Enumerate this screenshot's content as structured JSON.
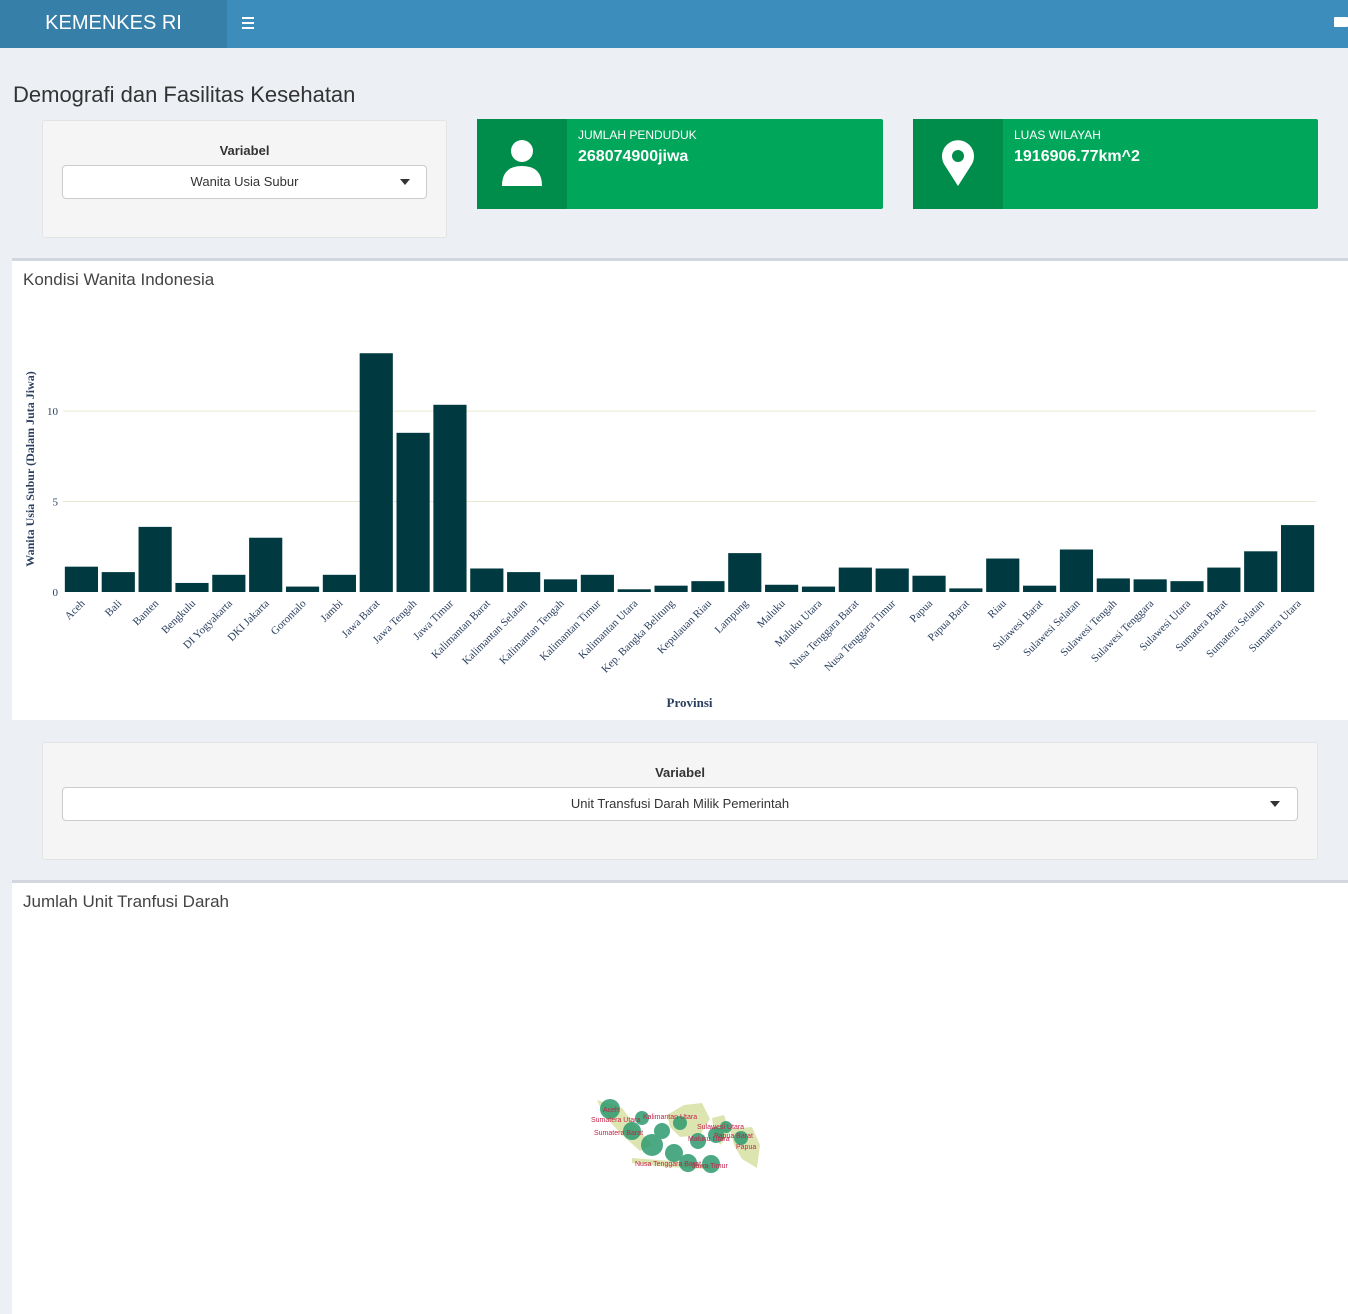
{
  "header": {
    "brand": "KEMENKES RI"
  },
  "page": {
    "title": "Demografi dan Fasilitas Kesehatan"
  },
  "filter_top": {
    "label": "Variabel",
    "selected": "Wanita Usia Subur"
  },
  "infobox_population": {
    "label": "JUMLAH PENDUDUK",
    "value": "268074900jiwa",
    "icon": "person-icon"
  },
  "infobox_area": {
    "label": "LUAS WILAYAH",
    "value": "1916906.77km^2",
    "icon": "map-marker-icon"
  },
  "chart_panel": {
    "title": "Kondisi Wanita Indonesia"
  },
  "filter_bottom": {
    "label": "Variabel",
    "selected": "Unit Transfusi Darah Milik Pemerintah"
  },
  "map_panel": {
    "title": "Jumlah Unit Tranfusi Darah"
  },
  "colors": {
    "header": "#3c8dbc",
    "brand": "#367fa9",
    "infobox": "#00a65a",
    "infobox_icon": "#008d4c",
    "bar": "#003a40"
  },
  "chart_data": {
    "type": "bar",
    "xlabel": "Provinsi",
    "ylabel": "Wanita Usia Subur (Dalam Juta Jiwa)",
    "ylim": [
      0,
      13.6
    ],
    "yticks": [
      0,
      5,
      10
    ],
    "grid": true,
    "categories": [
      "Aceh",
      "Bali",
      "Banten",
      "Bengkulu",
      "DI Yogyakarta",
      "DKI Jakarta",
      "Gorontalo",
      "Jambi",
      "Jawa Barat",
      "Jawa Tengah",
      "Jawa Timur",
      "Kalimantan Barat",
      "Kalimantan Selatan",
      "Kalimantan Tengah",
      "Kalimantan Timur",
      "Kalimantan Utara",
      "Kep. Bangka Belitung",
      "Kepulauan Riau",
      "Lampung",
      "Maluku",
      "Maluku Utara",
      "Nusa Tenggara Barat",
      "Nusa Tenggara Timur",
      "Papua",
      "Papua Barat",
      "Riau",
      "Sulawesi Barat",
      "Sulawesi Selatan",
      "Sulawesi Tengah",
      "Sulawesi Tenggara",
      "Sulawesi Utara",
      "Sumatera Barat",
      "Sumatera Selatan",
      "Sumatera Utara"
    ],
    "values": [
      1.4,
      1.1,
      3.6,
      0.5,
      0.95,
      3.0,
      0.3,
      0.95,
      13.2,
      8.8,
      10.35,
      1.3,
      1.1,
      0.7,
      0.95,
      0.15,
      0.35,
      0.6,
      2.15,
      0.4,
      0.3,
      1.35,
      1.3,
      0.9,
      0.2,
      1.85,
      0.35,
      2.35,
      0.75,
      0.7,
      0.6,
      1.35,
      2.25,
      3.7
    ]
  },
  "map_data": {
    "labels": [
      "Aceh",
      "Sumatera Utara",
      "Sumatera Barat",
      "Kalimantan Utara",
      "Sulawesi Utara",
      "Maluku Utara",
      "Papua Barat",
      "Papua",
      "Nusa Tenggara Barat",
      "Jawa Timur"
    ]
  }
}
